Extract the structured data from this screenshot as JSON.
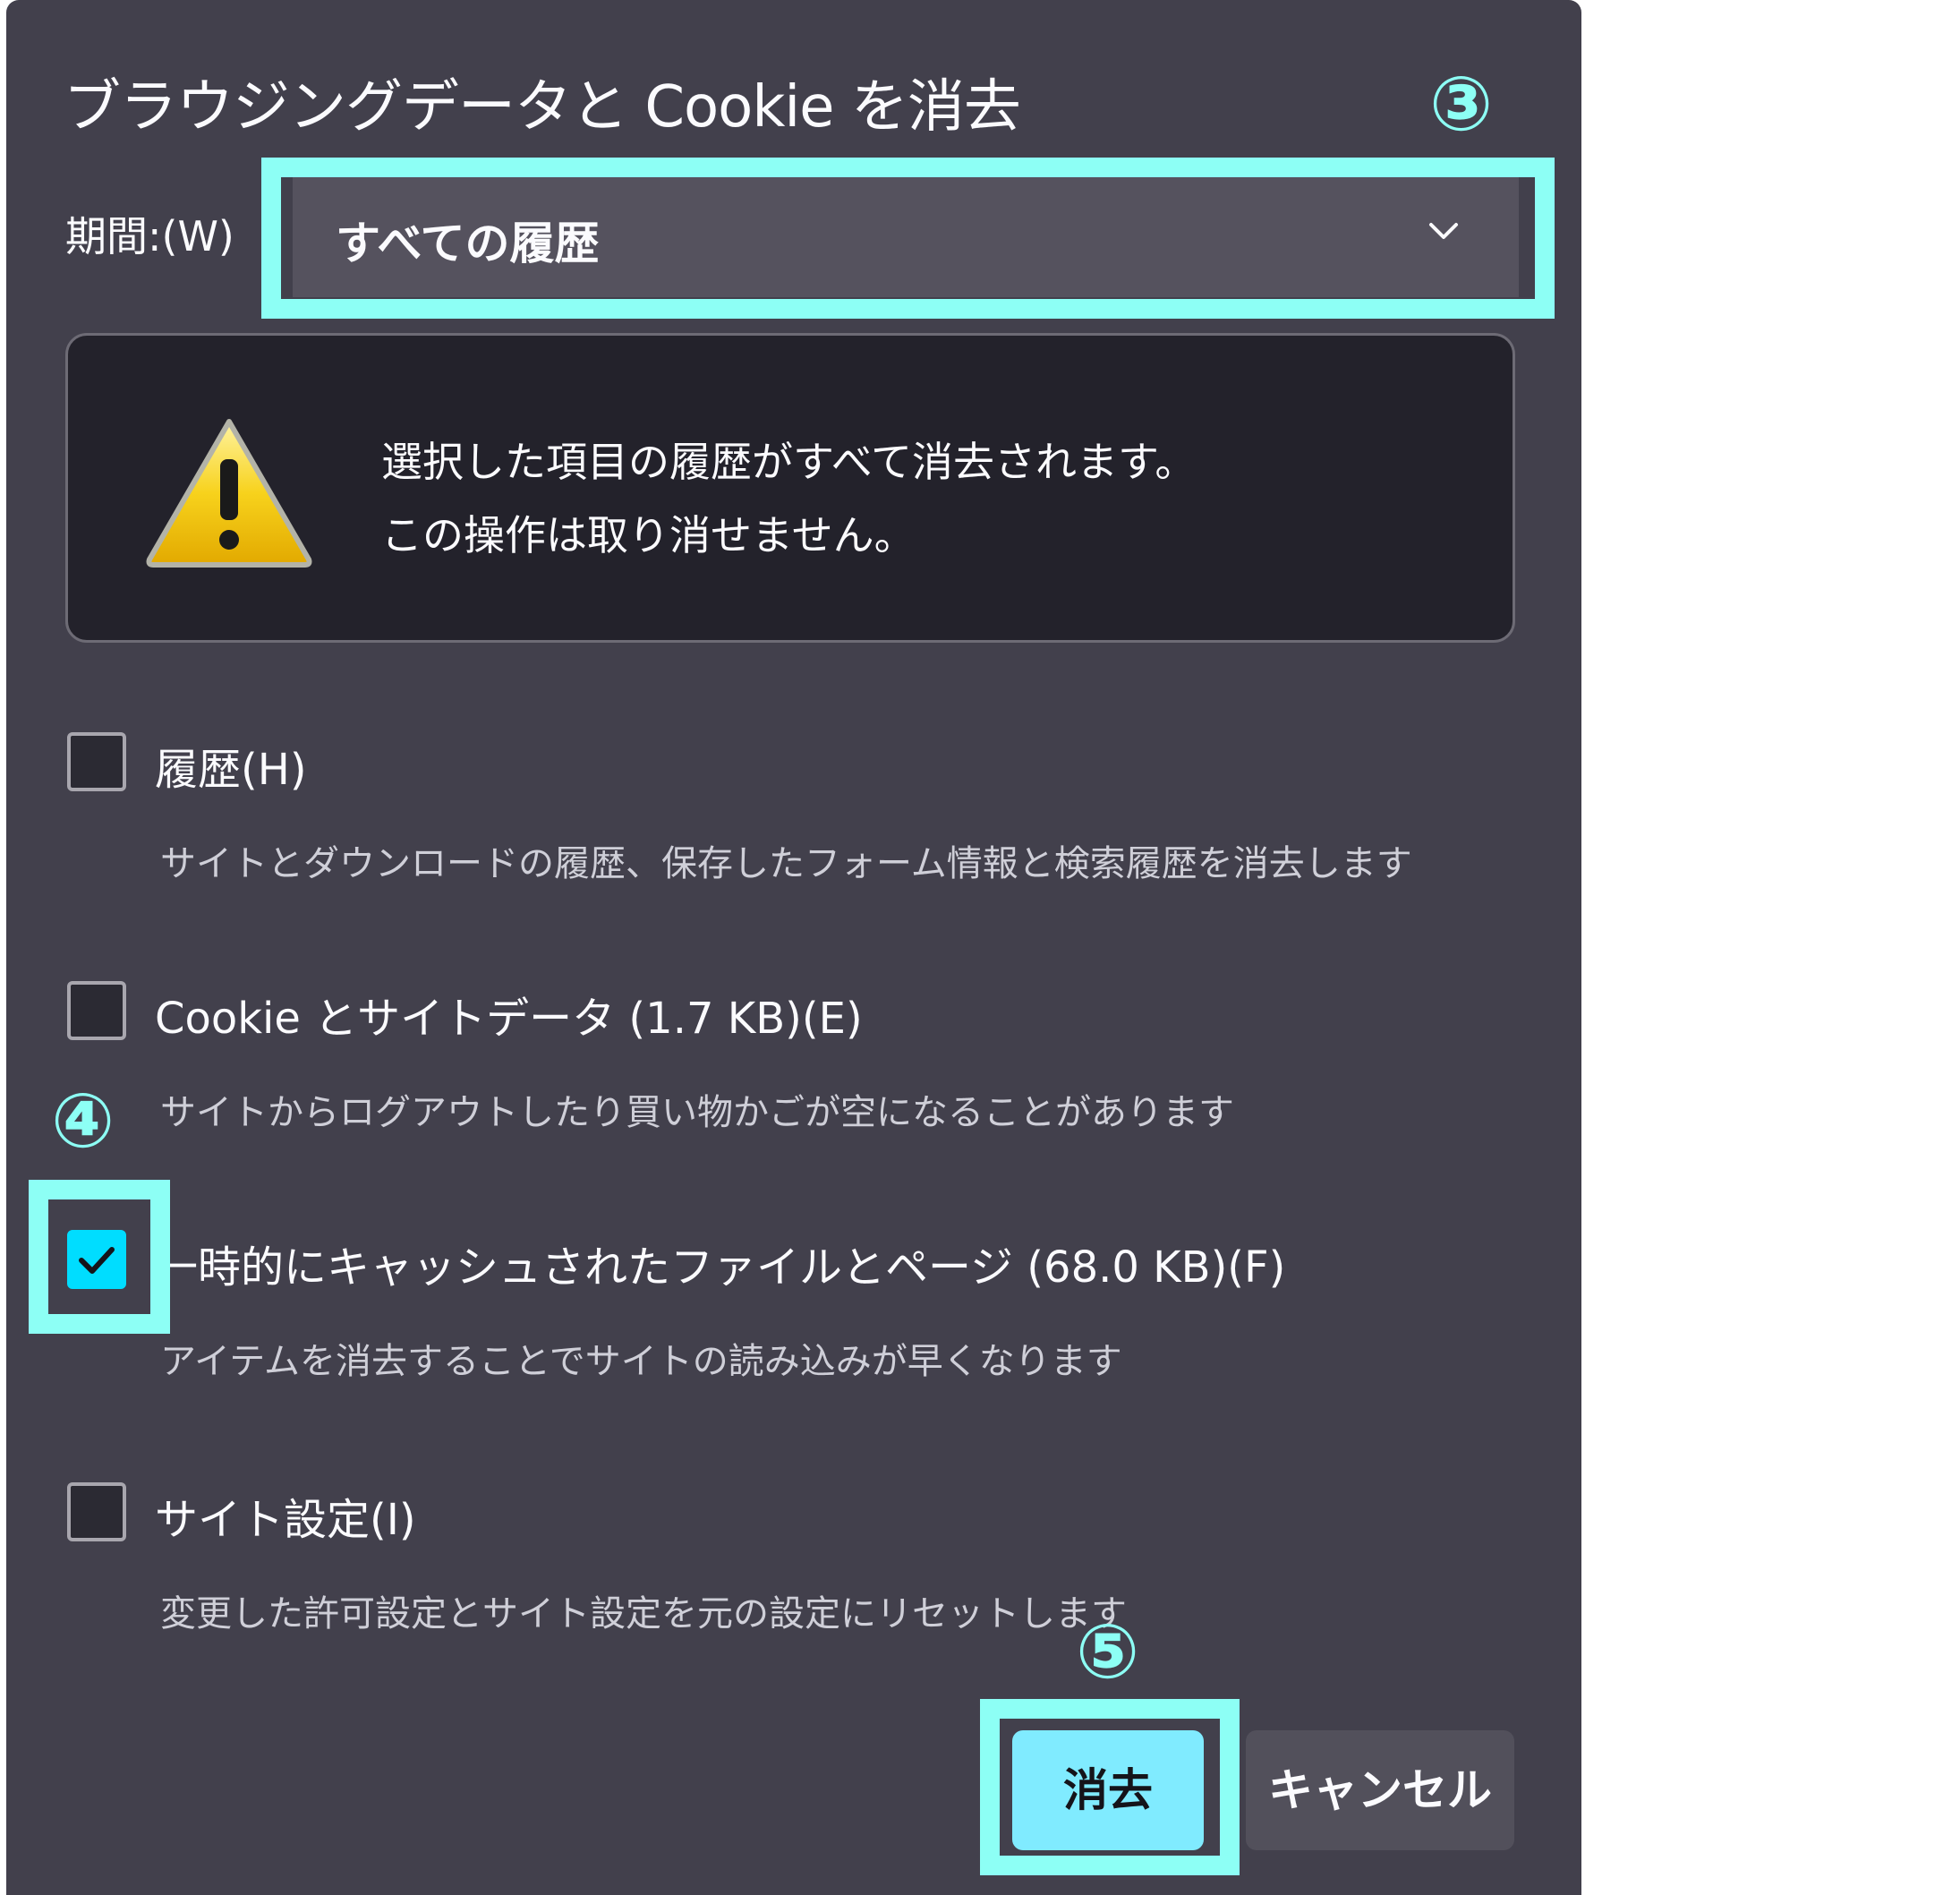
{
  "dialog": {
    "title": "ブラウジングデータと Cookie を消去"
  },
  "period": {
    "label": "期間:(W)",
    "selected": "すべての履歴"
  },
  "warning": {
    "line1": "選択した項目の履歴がすべて消去されます。",
    "line2": "この操作は取り消せません。"
  },
  "options": [
    {
      "label": "履歴(H)",
      "description": "サイトとダウンロードの履歴、保存したフォーム情報と検索履歴を消去します",
      "checked": false
    },
    {
      "label": "Cookie とサイトデータ (1.7 KB)(E)",
      "description": "サイトからログアウトしたり買い物かごが空になることがあります",
      "checked": false
    },
    {
      "label": "一時的にキャッシュされたファイルとページ (68.0 KB)(F)",
      "description": "アイテムを消去することでサイトの読み込みが早くなります",
      "checked": true
    },
    {
      "label": "サイト設定(I)",
      "description": "変更した許可設定とサイト設定を元の設定にリセットします",
      "checked": false
    }
  ],
  "buttons": {
    "clear": "消去",
    "cancel": "キャンセル"
  },
  "annotations": {
    "step3": "③",
    "step4": "④",
    "step5": "⑤"
  },
  "colors": {
    "dialog_bg": "#42404c",
    "highlight": "#8dfff5",
    "accent": "#00ddff",
    "primary_button": "#80ebff"
  }
}
